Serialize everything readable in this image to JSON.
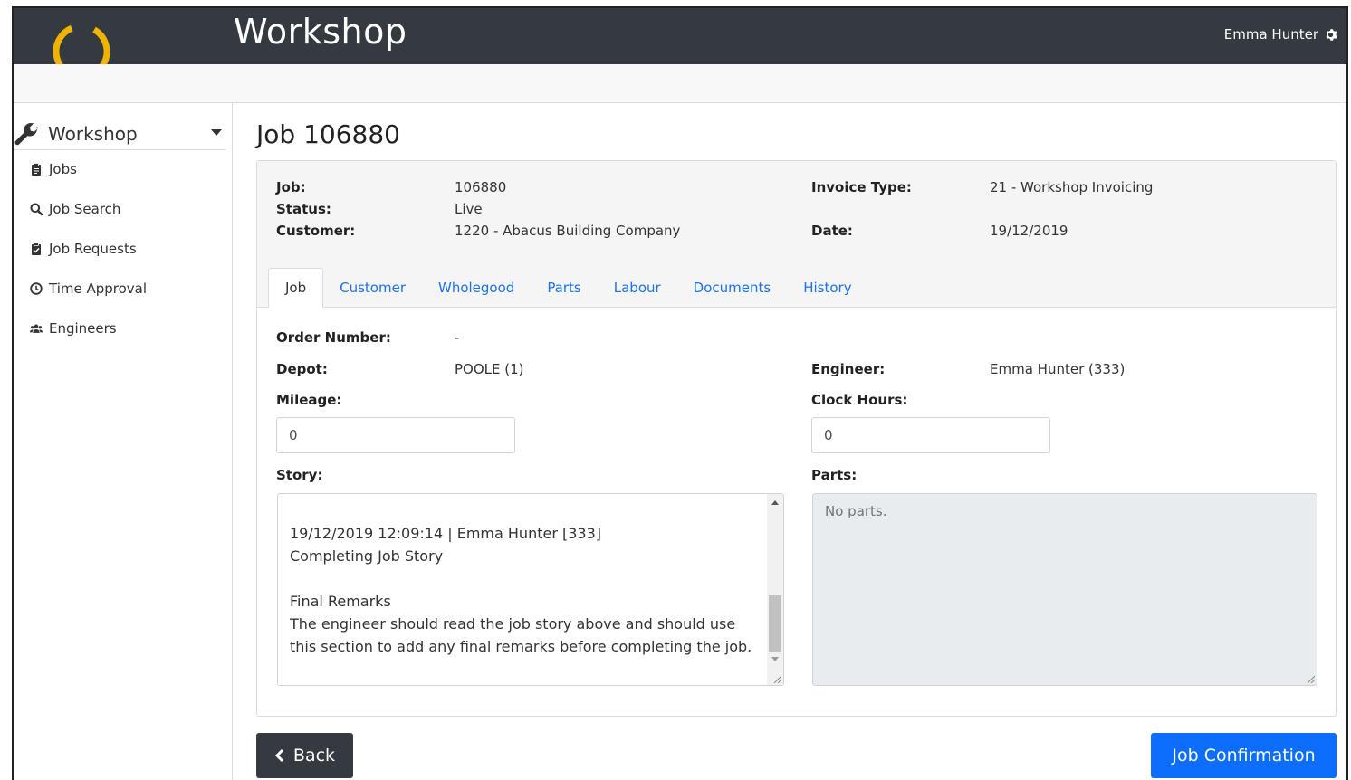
{
  "app": {
    "title": "Workshop",
    "user_name": "Emma Hunter",
    "user_icon": "gear-icon",
    "logo_color": "#f0b400"
  },
  "sidebar": {
    "header_label": "Workshop",
    "header_icon": "wrench-icon",
    "items": [
      {
        "label": "Jobs",
        "icon": "clipboard-icon"
      },
      {
        "label": "Job Search",
        "icon": "search-icon"
      },
      {
        "label": "Job Requests",
        "icon": "clipboard-check-icon"
      },
      {
        "label": "Time Approval",
        "icon": "clock-icon"
      },
      {
        "label": "Engineers",
        "icon": "users-icon"
      }
    ]
  },
  "page": {
    "title": "Job 106880"
  },
  "summary": {
    "job_label": "Job:",
    "job_value": "106880",
    "status_label": "Status:",
    "status_value": "Live",
    "customer_label": "Customer:",
    "customer_value": "1220 - Abacus Building Company",
    "invoice_type_label": "Invoice Type:",
    "invoice_type_value": "21 - Workshop Invoicing",
    "date_label": "Date:",
    "date_value": "19/12/2019"
  },
  "tabs": [
    {
      "label": "Job",
      "active": true
    },
    {
      "label": "Customer",
      "active": false
    },
    {
      "label": "Wholegood",
      "active": false
    },
    {
      "label": "Parts",
      "active": false
    },
    {
      "label": "Labour",
      "active": false
    },
    {
      "label": "Documents",
      "active": false
    },
    {
      "label": "History",
      "active": false
    }
  ],
  "job_tab": {
    "order_number_label": "Order Number:",
    "order_number_value": "-",
    "depot_label": "Depot:",
    "depot_value": "POOLE (1)",
    "engineer_label": "Engineer:",
    "engineer_value": "Emma Hunter (333)",
    "mileage_label": "Mileage:",
    "mileage_value": "0",
    "clock_hours_label": "Clock Hours:",
    "clock_hours_value": "0",
    "story_label": "Story:",
    "story_text": "19/12/2019 12:09:14 | Emma Hunter [333]\nCompleting Job Story\n\nFinal Remarks\nThe engineer should read the job story above and should use this section to add any final remarks before completing the job.",
    "parts_label": "Parts:",
    "parts_value": "No parts."
  },
  "actions": {
    "back_label": "Back",
    "confirm_label": "Job Confirmation",
    "primary_color": "#0d6efd",
    "dark_color": "#343a40"
  }
}
